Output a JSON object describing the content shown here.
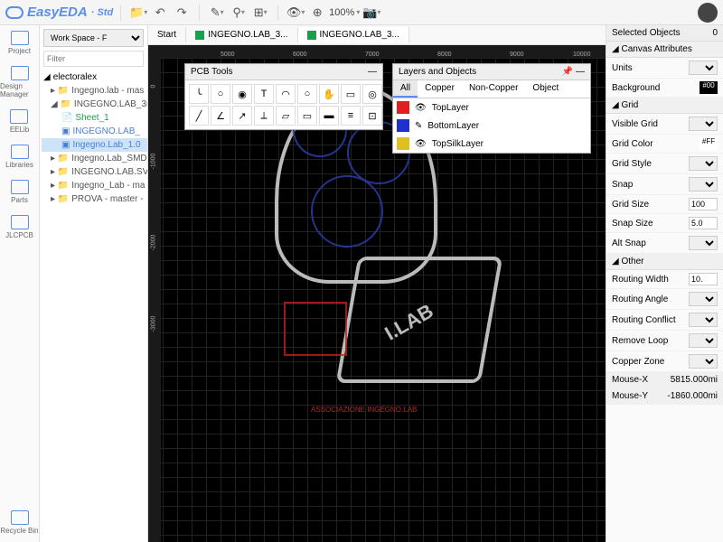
{
  "logo": {
    "name": "EasyEDA",
    "suffix": "Std"
  },
  "toolbar": {
    "zoom": "100%"
  },
  "leftcol": {
    "items": [
      "Project",
      "Design Manager",
      "EELib",
      "Libraries",
      "Parts",
      "JLCPCB"
    ],
    "bottom": "Recycle Bin"
  },
  "treepanel": {
    "workspace": "Work Space - F",
    "filter_ph": "Filter",
    "root": "electoralex",
    "nodes": [
      "Ingegno.lab - mas",
      "INGEGNO.LAB_3r",
      "Sheet_1",
      "INGEGNO.LAB_",
      "Ingegno.Lab_1.0",
      "Ingegno.Lab_SMD",
      "INGEGNO.LAB.SV",
      "Ingegno_Lab - ma",
      "PROVA - master -"
    ]
  },
  "tabs": {
    "t0": "Start",
    "t1": "INGEGNO.LAB_3...",
    "t2": "INGEGNO.LAB_3..."
  },
  "ruler": {
    "h": [
      "5000",
      "6000",
      "7000",
      "8000",
      "9000",
      "10000"
    ],
    "v": [
      "0",
      "-1000",
      "-2000",
      "-3000"
    ]
  },
  "pcbtools": {
    "title": "PCB Tools"
  },
  "layers": {
    "title": "Layers and Objects",
    "tabs": [
      "All",
      "Copper",
      "Non-Copper",
      "Object"
    ],
    "rows": [
      {
        "name": "TopLayer",
        "color": "#e02020"
      },
      {
        "name": "BottomLayer",
        "color": "#2030d0"
      },
      {
        "name": "TopSilkLayer",
        "color": "#e0c020"
      }
    ]
  },
  "art": {
    "lab": "I.LAB",
    "red": "ASSOCIAZIONE INGEGNO.LAB"
  },
  "right": {
    "sel_label": "Selected Objects",
    "sel_count": "0",
    "sect_canvas": "Canvas Attributes",
    "units_l": "Units",
    "bg_l": "Background",
    "bg_v": "#00",
    "sect_grid": "Grid",
    "vis_l": "Visible Grid",
    "gcolor_l": "Grid Color",
    "gcolor_v": "#FF",
    "gstyle_l": "Grid Style",
    "snap_l": "Snap",
    "gsize_l": "Grid Size",
    "gsize_v": "100",
    "ssize_l": "Snap Size",
    "ssize_v": "5.0",
    "alts_l": "Alt Snap",
    "sect_other": "Other",
    "rw_l": "Routing Width",
    "rw_v": "10.",
    "ra_l": "Routing Angle",
    "rc_l": "Routing Conflict",
    "rl_l": "Remove Loop",
    "cz_l": "Copper Zone",
    "mx_l": "Mouse-X",
    "mx_v": "5815.000mi",
    "my_l": "Mouse-Y",
    "my_v": "-1860.000mi"
  }
}
